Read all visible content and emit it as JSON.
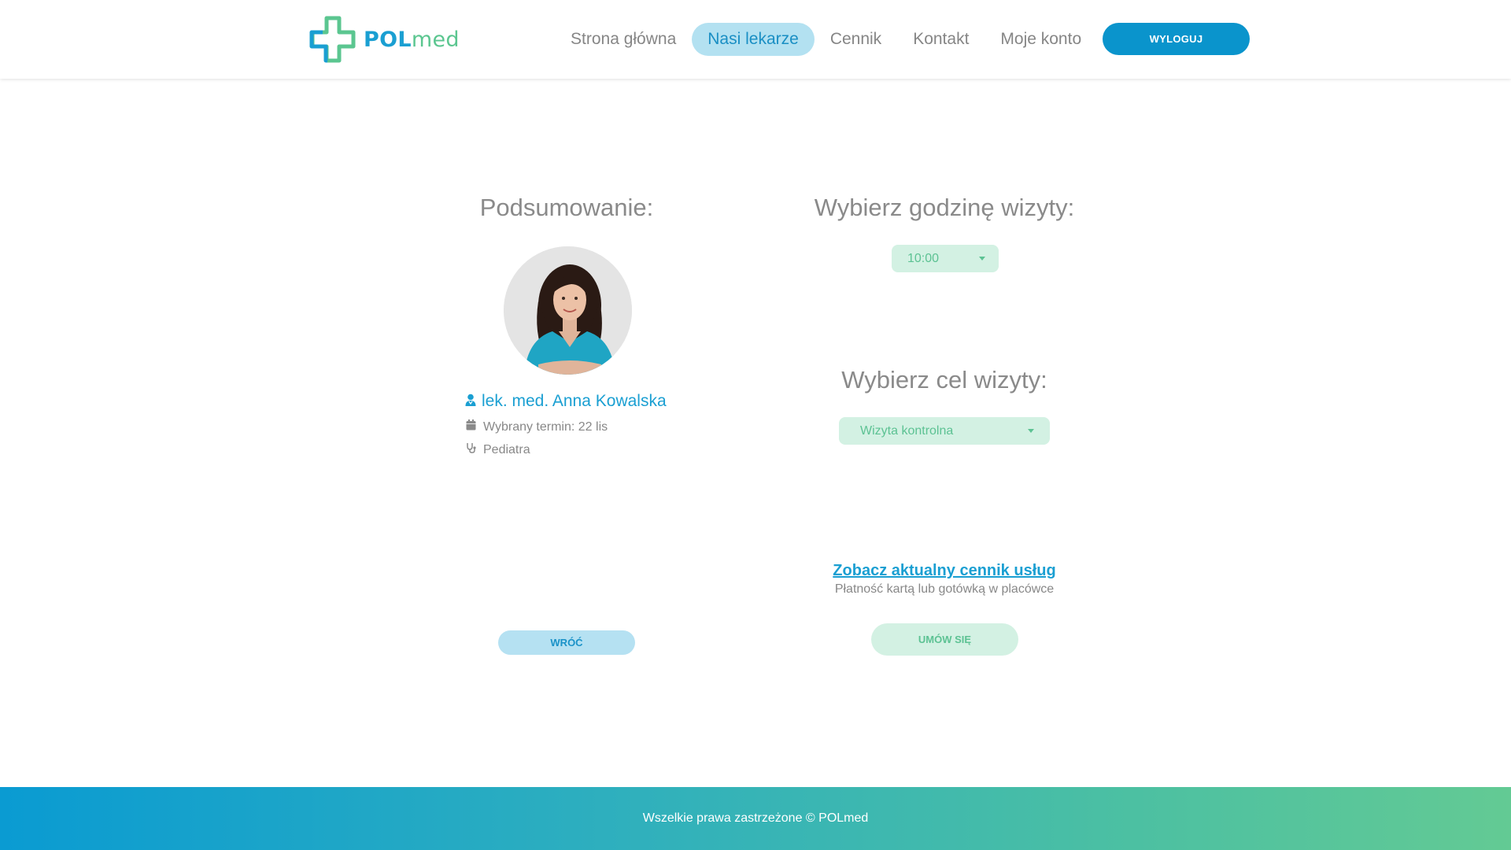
{
  "header": {
    "logo": {
      "part1": "POL",
      "part2": "med"
    },
    "nav": [
      {
        "label": "Strona główna",
        "active": false
      },
      {
        "label": "Nasi lekarze",
        "active": true
      },
      {
        "label": "Cennik",
        "active": false
      },
      {
        "label": "Kontakt",
        "active": false
      },
      {
        "label": "Moje konto",
        "active": false
      }
    ],
    "logout_label": "WYLOGUJ"
  },
  "summary": {
    "title": "Podsumowanie:",
    "doctor_name": "lek. med. Anna Kowalska",
    "selected_date": "Wybrany termin: 22 lis",
    "specialty": "Pediatra",
    "back_label": "WRÓĆ",
    "icons": {
      "doctor": "doctor-icon",
      "calendar": "calendar-icon",
      "stethoscope": "stethoscope-icon"
    }
  },
  "booking": {
    "hour_title": "Wybierz godzinę wizyty:",
    "hour_value": "10:00",
    "purpose_title": "Wybierz cel wizyty:",
    "purpose_value": "Wizyta kontrolna",
    "pricelist_link": "Zobacz aktualny cennik usług",
    "payment_note": "Płatność kartą lub gotówką w placówce",
    "book_label": "UMÓW SIĘ"
  },
  "footer": {
    "text": "Wszelkie prawa zastrzeżone © POLmed"
  },
  "colors": {
    "brand_blue": "#0a94cc",
    "brand_green": "#5cc293",
    "light_blue": "#b5e1f2",
    "light_green": "#d3f1e3",
    "gray_text": "#8a8a8a"
  }
}
